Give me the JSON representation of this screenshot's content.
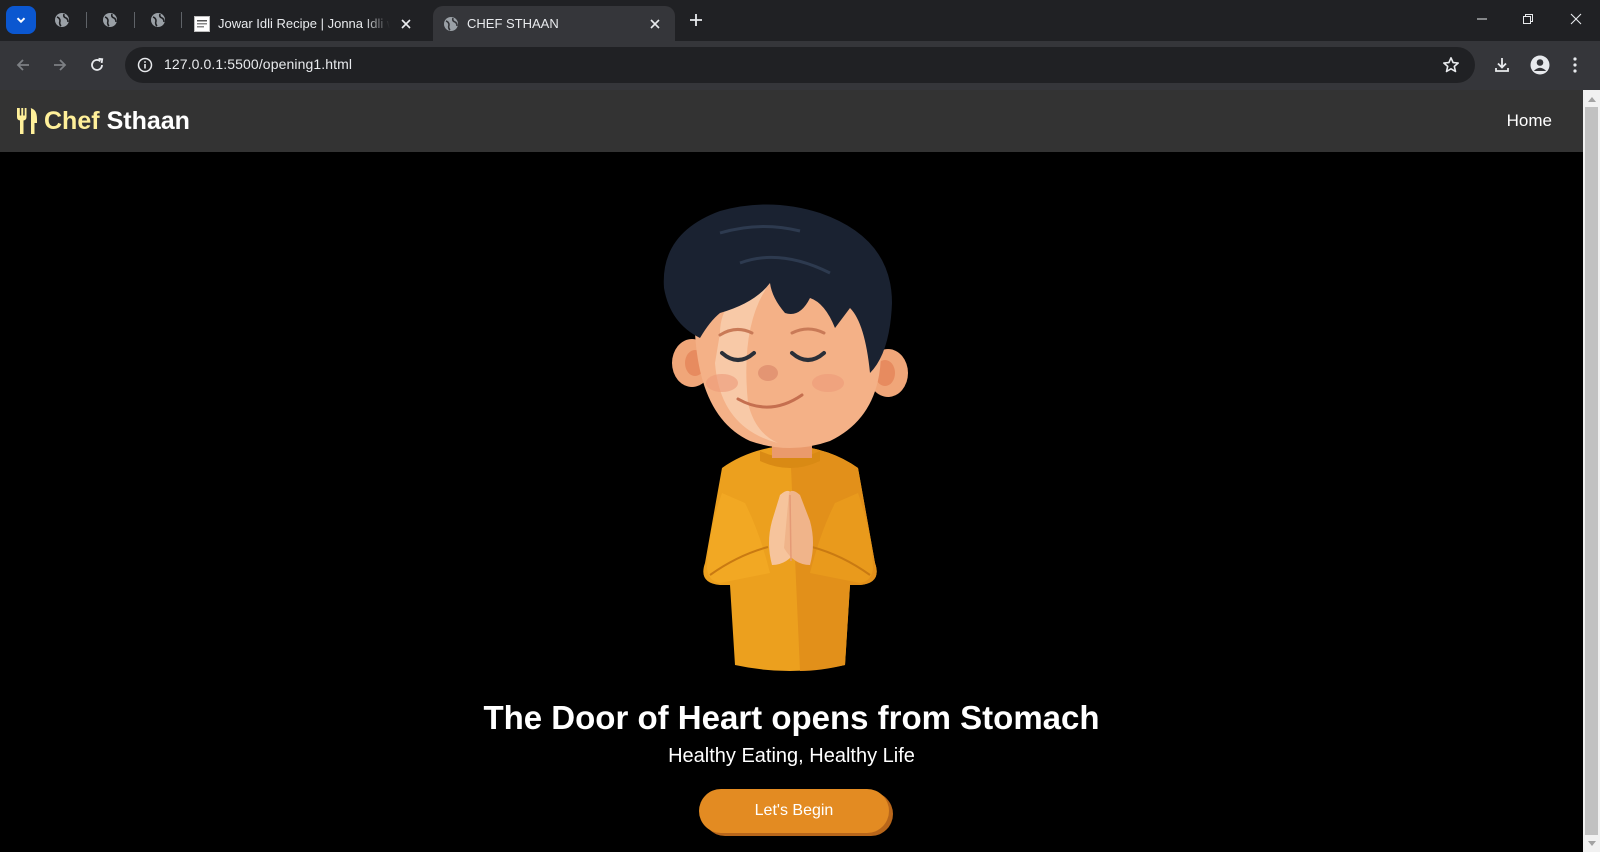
{
  "browser": {
    "tabs": [
      {
        "title": "Jowar Idli Recipe | Jonna Idli with",
        "favicon": "recipe-site-favicon"
      },
      {
        "title": "CHEF STHAAN",
        "favicon": "globe-icon",
        "active": true
      }
    ],
    "address_bar": {
      "url": "127.0.0.1:5500/opening1.html"
    }
  },
  "page": {
    "brand": {
      "icon": "utensils-icon",
      "first": "Chef",
      "second": "Sthaan",
      "accent_color": "#fff09a"
    },
    "nav": {
      "home_label": "Home"
    },
    "hero": {
      "image": "praying-chef-boy-illustration",
      "headline": "The Door of Heart opens from Stomach",
      "subheadline": "Healthy Eating, Healthy Life",
      "cta_label": "Let's Begin",
      "cta_color": "#e38b22"
    }
  }
}
